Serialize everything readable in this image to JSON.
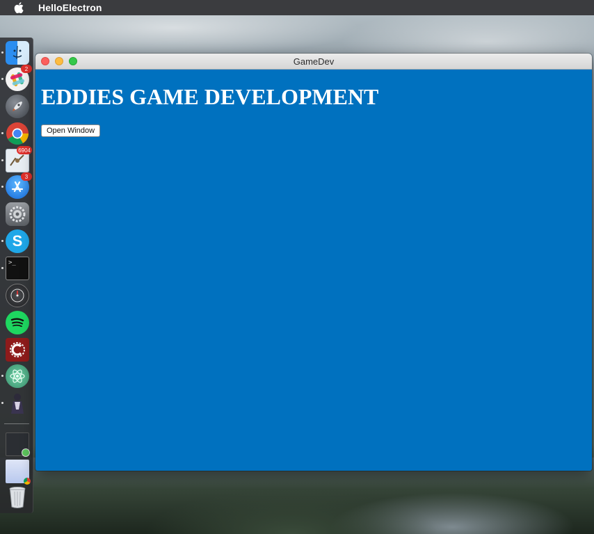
{
  "menubar": {
    "app_name": "HelloElectron"
  },
  "window": {
    "title": "GameDev",
    "heading": "EDDIES GAME DEVELOPMENT",
    "open_button_label": "Open Window",
    "background": "#0071bf"
  },
  "dock": {
    "items": [
      {
        "name": "finder",
        "badge": ""
      },
      {
        "name": "slack",
        "badge": "2"
      },
      {
        "name": "launchpad",
        "badge": ""
      },
      {
        "name": "chrome",
        "badge": ""
      },
      {
        "name": "mail",
        "badge": "6904"
      },
      {
        "name": "app-store",
        "badge": "3"
      },
      {
        "name": "system-preferences",
        "badge": ""
      },
      {
        "name": "skype",
        "badge": ""
      },
      {
        "name": "terminal",
        "badge": ""
      },
      {
        "name": "disk-diag",
        "badge": ""
      },
      {
        "name": "spotify",
        "badge": ""
      },
      {
        "name": "app-c",
        "badge": ""
      },
      {
        "name": "atom",
        "badge": ""
      },
      {
        "name": "character-app",
        "badge": ""
      },
      {
        "name": "minimized-window-1",
        "badge": ""
      },
      {
        "name": "minimized-window-2",
        "badge": ""
      },
      {
        "name": "trash",
        "badge": ""
      }
    ]
  }
}
